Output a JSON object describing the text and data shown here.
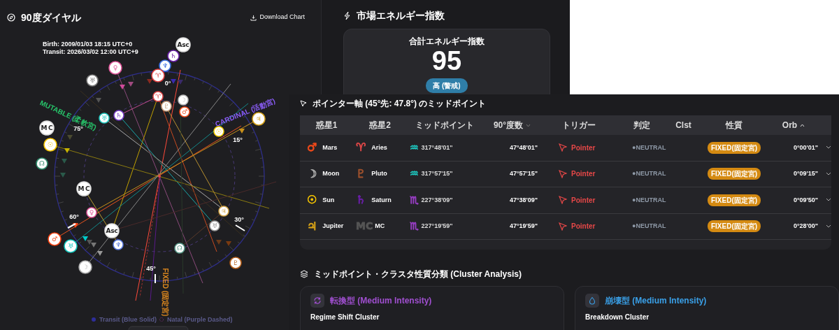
{
  "dial": {
    "title": "90度ダイヤル",
    "download": "Download Chart",
    "birth": "Birth: 2009/01/03 18:15 UTC+0",
    "transit": "Transit: 2026/03/02 12:00 UTC+9",
    "angle_labels": [
      "0°",
      "15°",
      "30°",
      "45°",
      "60°",
      "75°"
    ],
    "modality_labels": [
      {
        "text": "MUTABLE (柔軟宮)",
        "color": "#27c46a"
      },
      {
        "text": "CARDINAL (活動宮)",
        "color": "#8a5cf6"
      },
      {
        "text": "FIXED (固定宮)",
        "color": "#e08a1e"
      }
    ],
    "markers": [
      {
        "glyph": "Asc",
        "color": "#dddddd"
      },
      {
        "glyph": "♄",
        "color": "#6a1fa8"
      },
      {
        "glyph": "♆",
        "color": "#3b6fe0"
      },
      {
        "glyph": "♈",
        "color": "#e04040"
      },
      {
        "glyph": "♀",
        "color": "#e0559a"
      },
      {
        "glyph": "♅",
        "color": "#777777"
      },
      {
        "glyph": "MC",
        "color": "#dddddd"
      },
      {
        "glyph": "☉",
        "color": "#f5c400"
      },
      {
        "glyph": "☊",
        "color": "#2e8a6a"
      },
      {
        "glyph": "♂",
        "color": "#f04010"
      },
      {
        "glyph": "♅",
        "color": "#12c8c0"
      },
      {
        "glyph": "☽",
        "color": "#aaaaaa"
      },
      {
        "glyph": "♇",
        "color": "#b8601a"
      },
      {
        "glyph": "♃",
        "color": "#d4a017"
      },
      {
        "glyph": "♈",
        "color": "#e04848"
      },
      {
        "glyph": "♇",
        "color": "#c8a080"
      },
      {
        "glyph": "☽",
        "color": "#bbbbbb"
      },
      {
        "glyph": "♂",
        "color": "#f05020"
      },
      {
        "glyph": "♅",
        "color": "#1ec8c0"
      },
      {
        "glyph": "♄",
        "color": "#7a3fc8"
      },
      {
        "glyph": "☉",
        "color": "#f5d000"
      },
      {
        "glyph": "MC",
        "color": "#dddddd"
      },
      {
        "glyph": "♀",
        "color": "#e0559a"
      },
      {
        "glyph": "Asc",
        "color": "#dddddd"
      },
      {
        "glyph": "♆",
        "color": "#5a7ae0"
      },
      {
        "glyph": "☊",
        "color": "#5a9a8a"
      },
      {
        "glyph": "♅",
        "color": "#999999"
      },
      {
        "glyph": "♃",
        "color": "#d4a64a"
      }
    ],
    "legend": [
      {
        "label": "Transit (Blue Solid)",
        "kind": "solid"
      },
      {
        "label": "Natal (Purple Dashed)",
        "kind": "dashed"
      }
    ]
  },
  "energy": {
    "title": "市場エネルギー指数",
    "label": "合計エネルギー指数",
    "value": "95",
    "badge": "高 (警戒)"
  },
  "pointer_table": {
    "title": "ポインター軸 (45°先: 47.8°) のミッドポイント",
    "columns": [
      {
        "label": "惑星1"
      },
      {
        "label": "惑星2"
      },
      {
        "label": "ミッドポイント"
      },
      {
        "label": "90°度数",
        "sorted": true,
        "descending": true
      },
      {
        "label": "トリガー"
      },
      {
        "label": "判定"
      },
      {
        "label": "Clst"
      },
      {
        "label": "性質"
      },
      {
        "label": "Orb",
        "sorted": true,
        "descending": false
      }
    ],
    "rows": [
      {
        "planet1": {
          "glyph": "♂",
          "name": "Mars",
          "color": "#f04a1a"
        },
        "planet2": {
          "glyph": "♈",
          "name": "Aries",
          "color": "#e04848"
        },
        "sign": {
          "glyph": "♒",
          "color": "#1ec8c0"
        },
        "midpoint": "317°48'01\"",
        "deg90": "47°48'01\"",
        "trigger": "Pointer",
        "judgement": "●NEUTRAL",
        "quality": "FIXED(固定宮)",
        "orb": "0°00'01\""
      },
      {
        "planet1": {
          "glyph": "☽",
          "name": "Moon",
          "color": "#aaaaaa"
        },
        "planet2": {
          "glyph": "♇",
          "name": "Pluto",
          "color": "#a0522d"
        },
        "sign": {
          "glyph": "♒",
          "color": "#1ec8c0"
        },
        "midpoint": "317°57'15\"",
        "deg90": "47°57'15\"",
        "trigger": "Pointer",
        "judgement": "●NEUTRAL",
        "quality": "FIXED(固定宮)",
        "orb": "0°09'15\""
      },
      {
        "planet1": {
          "glyph": "☉",
          "name": "Sun",
          "color": "#f5c400"
        },
        "planet2": {
          "glyph": "♄",
          "name": "Saturn",
          "color": "#6a1fa8"
        },
        "sign": {
          "glyph": "♏",
          "color": "#9b3fc8"
        },
        "midpoint": "227°38'09\"",
        "deg90": "47°38'09\"",
        "trigger": "Pointer",
        "judgement": "●NEUTRAL",
        "quality": "FIXED(固定宮)",
        "orb": "0°09'50\""
      },
      {
        "planet1": {
          "glyph": "♃",
          "name": "Jupiter",
          "color": "#d4a017"
        },
        "planet2": {
          "glyph": "MC",
          "name": "MC",
          "color": "#555555"
        },
        "sign": {
          "glyph": "♏",
          "color": "#9b3fc8"
        },
        "midpoint": "227°19'59\"",
        "deg90": "47°19'59\"",
        "trigger": "Pointer",
        "judgement": "●NEUTRAL",
        "quality": "FIXED(固定宮)",
        "orb": "0°28'00\""
      }
    ]
  },
  "clusters": {
    "title": "ミッドポイント・クラスタ性質分類 (Cluster Analysis)",
    "cards": [
      {
        "kind": "regime",
        "title": "転換型 (Medium Intensity)",
        "color": "#a04fd0",
        "subtitle": "Regime Shift Cluster"
      },
      {
        "kind": "breakdown",
        "title": "崩壊型 (Medium Intensity)",
        "color": "#3aa0e8",
        "subtitle": "Breakdown Cluster"
      }
    ]
  }
}
